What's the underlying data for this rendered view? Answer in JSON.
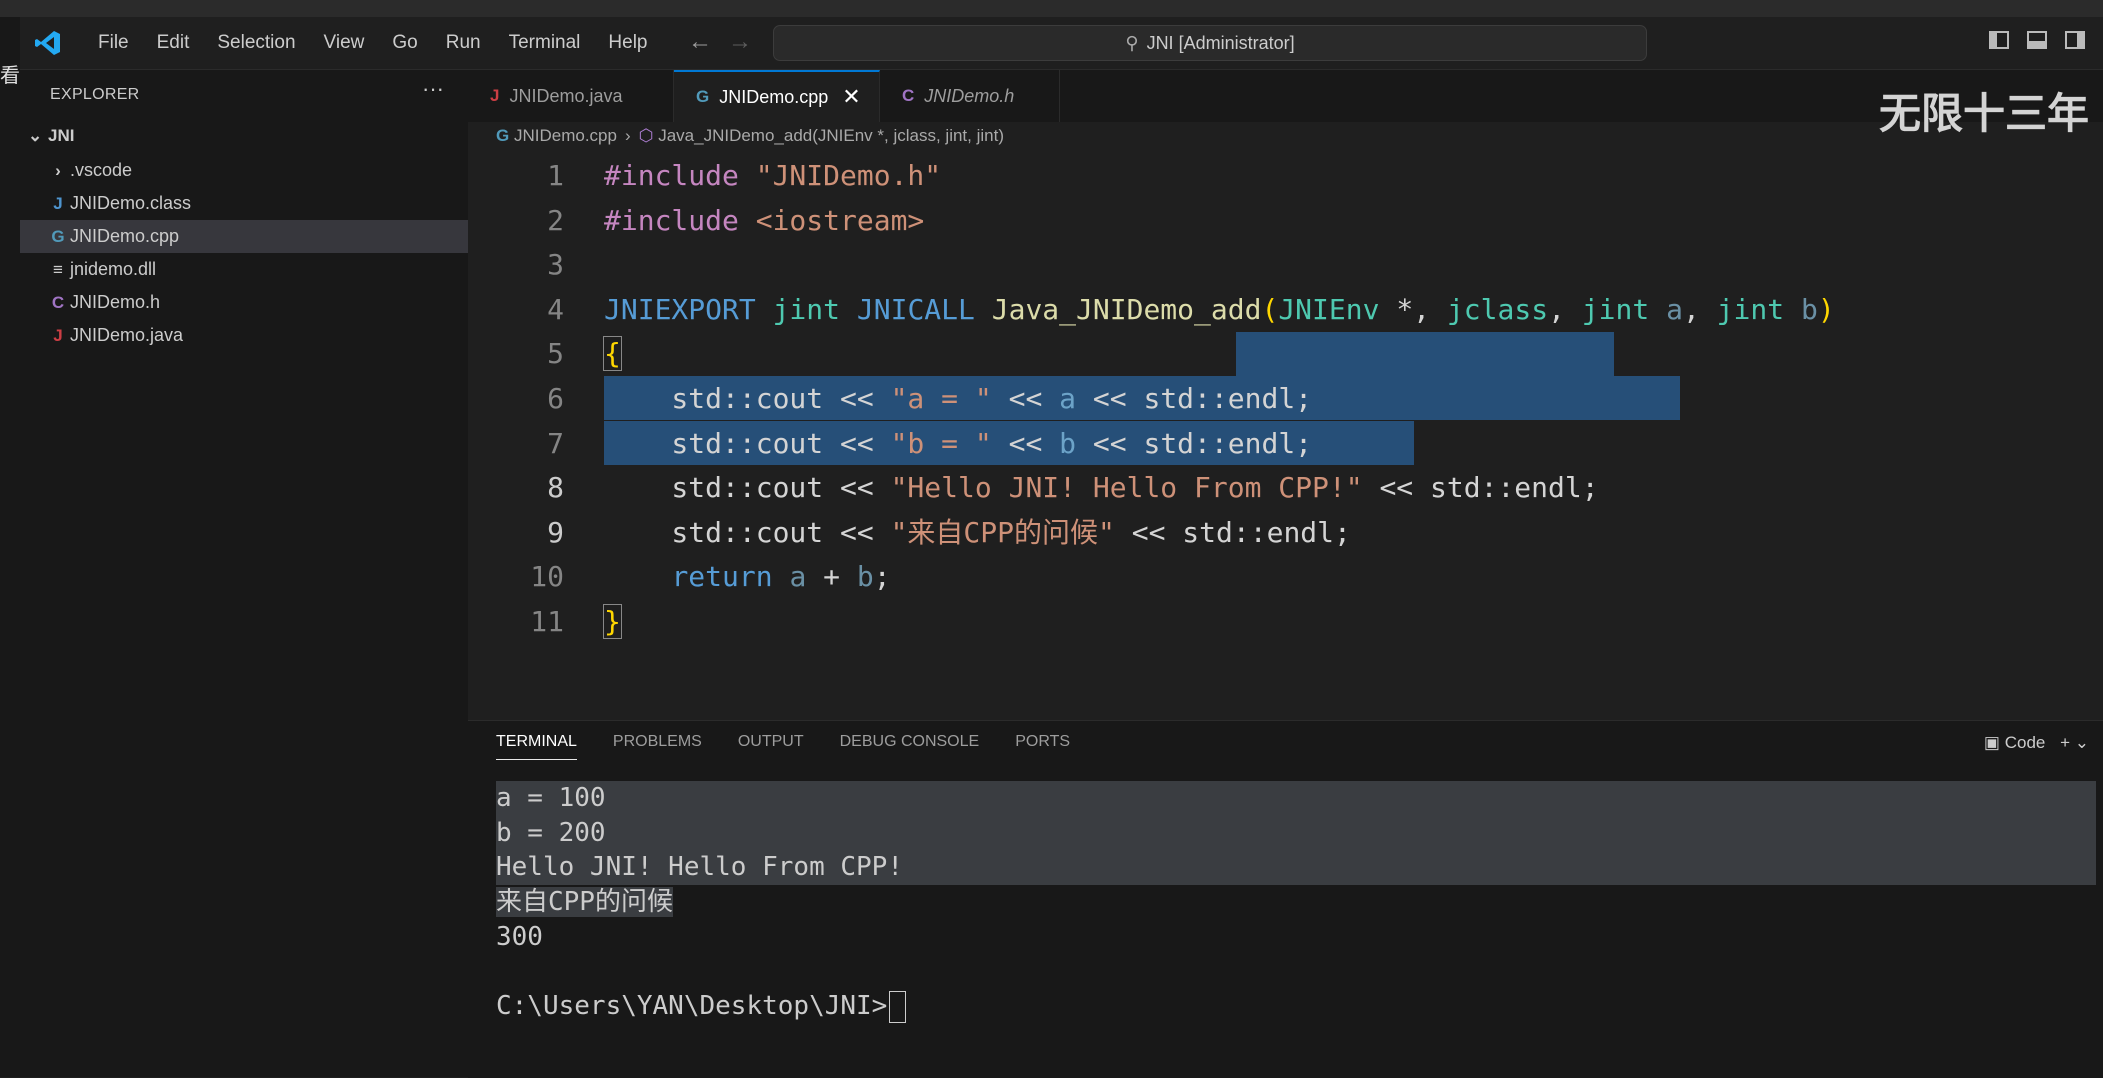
{
  "menu": [
    "File",
    "Edit",
    "Selection",
    "View",
    "Go",
    "Run",
    "Terminal",
    "Help"
  ],
  "command_center": "JNI [Administrator]",
  "left_strip_glyph": "看",
  "sidebar": {
    "header": "EXPLORER",
    "more": "···",
    "folder": "JNI",
    "items": [
      {
        "icon": "›",
        "label": ".vscode"
      },
      {
        "icon": "J",
        "label": "JNIDemo.class"
      },
      {
        "icon": "G",
        "label": "JNIDemo.cpp"
      },
      {
        "icon": "≡",
        "label": "jnidemo.dll"
      },
      {
        "icon": "C",
        "label": "JNIDemo.h"
      },
      {
        "icon": "J",
        "label": "JNIDemo.java"
      }
    ]
  },
  "tabs": [
    {
      "icon": "J",
      "label": "JNIDemo.java"
    },
    {
      "icon": "G",
      "label": "JNIDemo.cpp",
      "close": "✕"
    },
    {
      "icon": "C",
      "label": "JNIDemo.h"
    }
  ],
  "watermark": "无限十三年",
  "breadcrumb": {
    "file": "JNIDemo.cpp",
    "sep": "›",
    "symbol": "Java_JNIDemo_add(JNIEnv *, jclass, jint, jint)"
  },
  "line_numbers": [
    "1",
    "2",
    "3",
    "4",
    "5",
    "6",
    "7",
    "8",
    "9",
    "10",
    "11"
  ],
  "code": {
    "l1a": "#include ",
    "l1b": "\"JNIDemo.h\"",
    "l2a": "#include ",
    "l2b": "<iostream>",
    "l4a": "JNIEXPORT ",
    "l4b": "jint ",
    "l4c": "JNICALL ",
    "l4d": "Java_JNIDemo_add",
    "l4e": "(",
    "l4f": "JNIEnv ",
    "l4g": "*, ",
    "l4h": "jclass",
    "l4i": ", ",
    "l4j": "jint ",
    "l4k": "a",
    "l4l": ", ",
    "l4m": "jint ",
    "l4n": "b",
    "l4o": ")",
    "l5": "{",
    "l6a": "    std::cout << ",
    "l6b": "\"a = \"",
    "l6c": " << ",
    "l6d": "a",
    "l6e": " << std::endl;",
    "l7a": "    std::cout << ",
    "l7b": "\"b = \"",
    "l7c": " << ",
    "l7d": "b",
    "l7e": " << std::endl;",
    "l8a": "    std::cout << ",
    "l8b": "\"Hello JNI! Hello From CPP!\"",
    "l8c": " << std::endl;",
    "l9a": "    std::cout << ",
    "l9b": "\"来自CPP的问候\"",
    "l9c": " << std::endl;",
    "l10a": "    ",
    "l10b": "return ",
    "l10c": "a",
    " l10d": " + ",
    "l10e": "b",
    "l10f": ";",
    "l11": "}"
  },
  "panel": {
    "tabs": [
      "TERMINAL",
      "PROBLEMS",
      "OUTPUT",
      "DEBUG CONSOLE",
      "PORTS"
    ],
    "right": "Code",
    "plus": "+ ⌄"
  },
  "terminal": [
    "a = 100",
    "b = 200",
    "Hello JNI! Hello From CPP!",
    "来自CPP的问候",
    "300",
    "",
    "C:\\Users\\YAN\\Desktop\\JNI>"
  ]
}
